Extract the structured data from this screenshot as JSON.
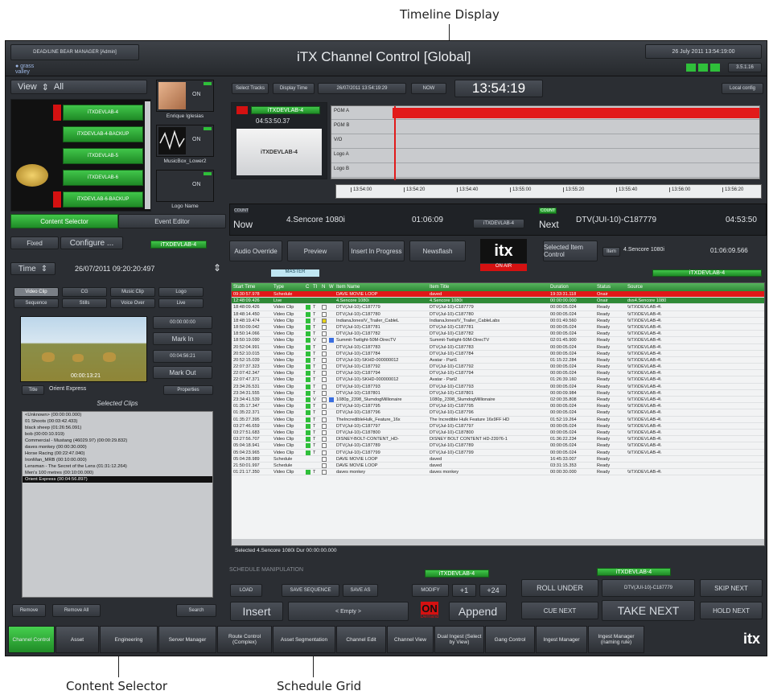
{
  "callouts": {
    "timeline": "Timeline Display",
    "content_selector": "Content Selector",
    "schedule_grid": "Schedule Grid"
  },
  "header": {
    "title": "iTX Channel Control [Global]",
    "user_label": "DEAD/LINE BEAR MANAGER [Admin]",
    "date": "26 July 2011 13:54:19:00",
    "version": "3.5.1.16"
  },
  "toolbar": {
    "view_label": "View",
    "view_value": "All",
    "select_tracks": "Select Tracks",
    "display_time": "Display Time",
    "display_time_value": "26/07/2011 13:54:19:29",
    "now_label": "NOW",
    "clock": "13:54:19",
    "local_config": "Local config"
  },
  "channels": [
    {
      "label": "iTXDEVLAB-4",
      "status": "on"
    },
    {
      "label": "iTXDEVLAB-4-BACKUP",
      "status": "off"
    },
    {
      "label": "iTXDEVLAB-5",
      "status": "off"
    },
    {
      "label": "iTXDEVLAB-6",
      "status": "off"
    },
    {
      "label": "iTXDEVLAB-6-BACKUP",
      "status": "on"
    }
  ],
  "presenters": [
    {
      "name": "Enrique Iglesias",
      "state": "ON"
    },
    {
      "name": "MusicBox_Lower2",
      "state": "ON"
    },
    {
      "name": "Logo Name",
      "state": "ON"
    }
  ],
  "preview": {
    "channel": "iTXDEVLAB-4",
    "time": "04:53:50.37"
  },
  "timeline": {
    "tracks": [
      "PGM A",
      "PGM B",
      "V/O",
      "Logo A",
      "Logo B"
    ],
    "ticks": [
      "13:54:00",
      "13:54:20",
      "13:54:40",
      "13:55:00",
      "13:55:20",
      "13:55:40",
      "13:56:00",
      "13:56:20"
    ]
  },
  "tabs_left": {
    "content_selector": "Content Selector",
    "event_editor": "Event Editor"
  },
  "fixed": {
    "label": "Fixed",
    "configure": "Configure ...",
    "channel": "iTXDEVLAB-4"
  },
  "time_row": {
    "label": "Time",
    "value": "26/07/2011 09:20:20:497"
  },
  "media_types": [
    "Video Clip",
    "CG",
    "Music Clip",
    "Logo",
    "Sequence",
    "Stills",
    "Voice Over",
    "Live"
  ],
  "clip_preview": {
    "timecode": "00:00:13:21",
    "in_time": "00:00:00:00",
    "out_time": "00:04:56:21",
    "mark_in": "Mark In",
    "mark_out": "Mark Out",
    "title_label": "Title",
    "title_value": "Orient Express",
    "properties": "Properties"
  },
  "selected_clips": {
    "header": "Selected Clips",
    "items": [
      "<Unknown> (00:00:00.000)",
      "01 Shoots (00:03:42.433)",
      "black sheep (01:26:56.091)",
      "bob (00:00:10.919)",
      "Commercial - Mustang (46029.97) (00:00:29.832)",
      "daves monkey (00:00:30.000)",
      "Horse Racing (00:22:47.040)",
      "IronMan_MRB (00:10:00.000)",
      "Lensman - The Secret of the Lens (01:31:12.264)",
      "Men's 100 metres (00:10:00.000)",
      "Orient Express (00:04:56.897)"
    ],
    "selected_index": 10
  },
  "left_buttons": {
    "remove": "Remove",
    "remove_all": "Remove All",
    "search": "Search"
  },
  "now_next": {
    "count": "COUNT",
    "now": "Now",
    "now_item": "4.Sencore 1080i",
    "now_duration": "01:06:09",
    "channel": "iTXDEVLAB-4",
    "next": "Next",
    "next_item": "DTV(JUI-10)-C187779",
    "next_time": "04:53:50"
  },
  "action_bar": {
    "audio_override": "Audio Override",
    "preview": "Preview",
    "insert_progress": "Insert In Progress",
    "newsflash": "Newsflash",
    "logo": "itx",
    "on_air": "ON AIR",
    "selected_item_control": "Selected Item Control",
    "item_label": "Item",
    "item_value": "4.Sencore 1080i",
    "item_duration": "01:06:09.566"
  },
  "master_label": "MASTER",
  "channel_strip": "iTXDEVLAB-4",
  "grid": {
    "columns": [
      "Start Time",
      "Type",
      "C",
      "TI",
      "N",
      "W",
      "Item Name",
      "Item Title",
      "Duration",
      "Status",
      "Source"
    ],
    "rows": [
      [
        "09:30:57.978",
        "Schedule",
        "",
        "",
        "",
        "",
        "DAVE MOVIE LOOP",
        "daved",
        "19:33:31.118",
        "Onair",
        ""
      ],
      [
        "12:48:09.426",
        "Live",
        "",
        "",
        "",
        "",
        "4.Sencore 1080i",
        "4.Sencore 1080i",
        "00:00:00.000",
        "Onair",
        "dvs4.Sencore 1080"
      ],
      [
        "18:48:09.426",
        "Video Clip",
        "",
        "T",
        "",
        "-",
        "DTV(Jul-10)-C187779",
        "DTV(Jul-10)-C187779",
        "00:00:05.024",
        "Ready",
        "\\\\iTX\\DEVLAB-4\\"
      ],
      [
        "18:48:14.450",
        "Video Clip",
        "",
        "T",
        "",
        "-",
        "DTV(Jul-10)-C187780",
        "DTV(Jul-10)-C187780",
        "00:00:05.024",
        "Ready",
        "\\\\iTX\\DEVLAB-4\\"
      ],
      [
        "18:48:19.474",
        "Video Clip",
        "",
        "T",
        "",
        "-",
        "IndianaJonesIV_Trailer_CableL",
        "IndianaJonesIV_Trailer_CableLabs",
        "00:01:49.560",
        "Ready",
        "\\\\iTX\\DEVLAB-4\\"
      ],
      [
        "18:50:09.042",
        "Video Clip",
        "",
        "T",
        "",
        "-",
        "DTV(Jul-10)-C187781",
        "DTV(Jul-10)-C187781",
        "00:00:05.024",
        "Ready",
        "\\\\iTX\\DEVLAB-4\\"
      ],
      [
        "18:50:14.066",
        "Video Clip",
        "",
        "T",
        "",
        "-",
        "DTV(Jul-10)-C187782",
        "DTV(Jul-10)-C187782",
        "00:00:05.024",
        "Ready",
        "\\\\iTX\\DEVLAB-4\\"
      ],
      [
        "18:50:19.090",
        "Video Clip",
        "",
        "V",
        "",
        "-",
        "Summit-Twilight-50M-DirecTV",
        "Summit-Twilight-50M-DirecTV",
        "02:01:45.900",
        "Ready",
        "\\\\iTX\\DEVLAB-4\\"
      ],
      [
        "20:52:04.991",
        "Video Clip",
        "",
        "T",
        "",
        "-",
        "DTV(Jul-10)-C187783",
        "DTV(Jul-10)-C187783",
        "00:00:05.024",
        "Ready",
        "\\\\iTX\\DEVLAB-4\\"
      ],
      [
        "20:52:10.015",
        "Video Clip",
        "",
        "T",
        "",
        "-",
        "DTV(Jul-10)-C187784",
        "DTV(Jul-10)-C187784",
        "00:00:05.024",
        "Ready",
        "\\\\iTX\\DEVLAB-4\\"
      ],
      [
        "20:52:15.039",
        "Video Clip",
        "",
        "T",
        "",
        "-",
        "DTV(Jul-10)-SKHD-000000012",
        "Avatar - Part1",
        "01:15:22.284",
        "Ready",
        "\\\\iTX\\DEVLAB-4\\"
      ],
      [
        "22:07:37.323",
        "Video Clip",
        "",
        "T",
        "",
        "-",
        "DTV(Jul-10)-C187792",
        "DTV(Jul-10)-C187792",
        "00:00:05.024",
        "Ready",
        "\\\\iTX\\DEVLAB-4\\"
      ],
      [
        "22:07:42.347",
        "Video Clip",
        "",
        "T",
        "",
        "-",
        "DTV(Jul-10)-C187794",
        "DTV(Jul-10)-C187794",
        "00:00:05.024",
        "Ready",
        "\\\\iTX\\DEVLAB-4\\"
      ],
      [
        "22:07:47.371",
        "Video Clip",
        "",
        "T",
        "",
        "-",
        "DTV(Jul-10)-SKHD-000000012",
        "Avatar - Part2",
        "01:26:39.160",
        "Ready",
        "\\\\iTX\\DEVLAB-4\\"
      ],
      [
        "23:34:26.531",
        "Video Clip",
        "",
        "T",
        "",
        "-",
        "DTV(Jul-10)-C187793",
        "DTV(Jul-10)-C187793",
        "00:00:05.024",
        "Ready",
        "\\\\iTX\\DEVLAB-4\\"
      ],
      [
        "23:34:31.555",
        "Video Clip",
        "",
        "T",
        "",
        "-",
        "DTV(Jul-10)-C187801",
        "DTV(Jul-10)-C187801",
        "00:00:09.984",
        "Ready",
        "\\\\iTX\\DEVLAB-4\\"
      ],
      [
        "23:34:41.539",
        "Video Clip",
        "",
        "V",
        "",
        "-",
        "1080p_2398_SlumdogMillionaire",
        "1080p_2398_SlumdogMillionaire",
        "02:00:35.808",
        "Ready",
        "\\\\iTX\\DEVLAB-4\\"
      ],
      [
        "01:35:17.347",
        "Video Clip",
        "",
        "T",
        "",
        "-",
        "DTV(Jul-10)-C187795",
        "DTV(Jul-10)-C187795",
        "00:00:05.024",
        "Ready",
        "\\\\iTX\\DEVLAB-4\\"
      ],
      [
        "01:35:22.371",
        "Video Clip",
        "",
        "T",
        "",
        "-",
        "DTV(Jul-10)-C187796",
        "DTV(Jul-10)-C187796",
        "00:00:05.024",
        "Ready",
        "\\\\iTX\\DEVLAB-4\\"
      ],
      [
        "01:35:27.395",
        "Video Clip",
        "",
        "T",
        "",
        "-",
        "TheIncredibleHulk_Feature_16x",
        "The Incredible Hulk Feature 16x9FF HD",
        "01:52:19.264",
        "Ready",
        "\\\\iTX\\DEVLAB-4\\"
      ],
      [
        "03:27:46.659",
        "Video Clip",
        "",
        "T",
        "",
        "-",
        "DTV(Jul-10)-C187797",
        "DTV(Jul-10)-C187797",
        "00:00:05.024",
        "Ready",
        "\\\\iTX\\DEVLAB-4\\"
      ],
      [
        "03:27:51.683",
        "Video Clip",
        "",
        "T",
        "",
        "-",
        "DTV(Jul-10)-C187800",
        "DTV(Jul-10)-C187800",
        "00:00:05.024",
        "Ready",
        "\\\\iTX\\DEVLAB-4\\"
      ],
      [
        "03:27:56.707",
        "Video Clip",
        "",
        "T",
        "",
        "-",
        "DISNEY-BOLT-CONTENT_HD-",
        "DISNEY BOLT CONTENT HD-23976-1",
        "01:36:22.234",
        "Ready",
        "\\\\iTX\\DEVLAB-4\\"
      ],
      [
        "05:04:18.941",
        "Video Clip",
        "",
        "T",
        "",
        "-",
        "DTV(Jul-10)-C187789",
        "DTV(Jul-10)-C187789",
        "00:00:05.024",
        "Ready",
        "\\\\iTX\\DEVLAB-4\\"
      ],
      [
        "05:04:23.965",
        "Video Clip",
        "",
        "T",
        "",
        "-",
        "DTV(Jul-10)-C187799",
        "DTV(Jul-10)-C187799",
        "00:00:05.024",
        "Ready",
        "\\\\iTX\\DEVLAB-4\\"
      ],
      [
        "05:04:28.989",
        "Schedule",
        "",
        "",
        "",
        "-",
        "DAVE MOVIE LOOP",
        "daved",
        "16:45:33.007",
        "Ready",
        ""
      ],
      [
        "21:50:01.997",
        "Schedule",
        "",
        "",
        "",
        "-",
        "DAVE MOVIE LOOP",
        "daved",
        "03:31:15.353",
        "Ready",
        ""
      ],
      [
        "01:21:17.350",
        "Video Clip",
        "",
        "T",
        "",
        "-",
        "daves monkey",
        "daves monkey",
        "00:00:30.000",
        "Ready",
        "\\\\iTX\\DEVLAB-4\\"
      ]
    ],
    "status_text": "Selected 4.Sencore 1080i Dur 00:00:00.000"
  },
  "bottom_controls": {
    "schedule_manipulation": "SCHEDULE MANIPULATION",
    "channel": "iTXDEVLAB-4",
    "load": "LOAD",
    "save_sequence": "SAVE SEQUENCE",
    "save_as": "SAVE AS",
    "modify": "MODIFY",
    "plus1": "+1",
    "plus24": "+24",
    "insert": "Insert",
    "empty": "< Empty >",
    "on_demand": "Demand",
    "append": "Append",
    "roll_under": "ROLL UNDER",
    "next_item": "DTV(JUI-10)-C187779",
    "skip_next": "SKIP NEXT",
    "cue_next": "CUE NEXT",
    "take_next": "TAKE NEXT",
    "hold_next": "HOLD NEXT",
    "channel_right": "iTXDEVLAB-4"
  },
  "taskbar": [
    "Channel Control",
    "Asset",
    "Engineering",
    "Server Manager",
    "Route Control (Complex)",
    "Asset Segmentation",
    "Channel Edit",
    "Channel View",
    "Dual Ingest (Select by View)",
    "Gang Control",
    "Ingest Manager",
    "Ingest Manager (naming rule)"
  ],
  "brand": "itx"
}
